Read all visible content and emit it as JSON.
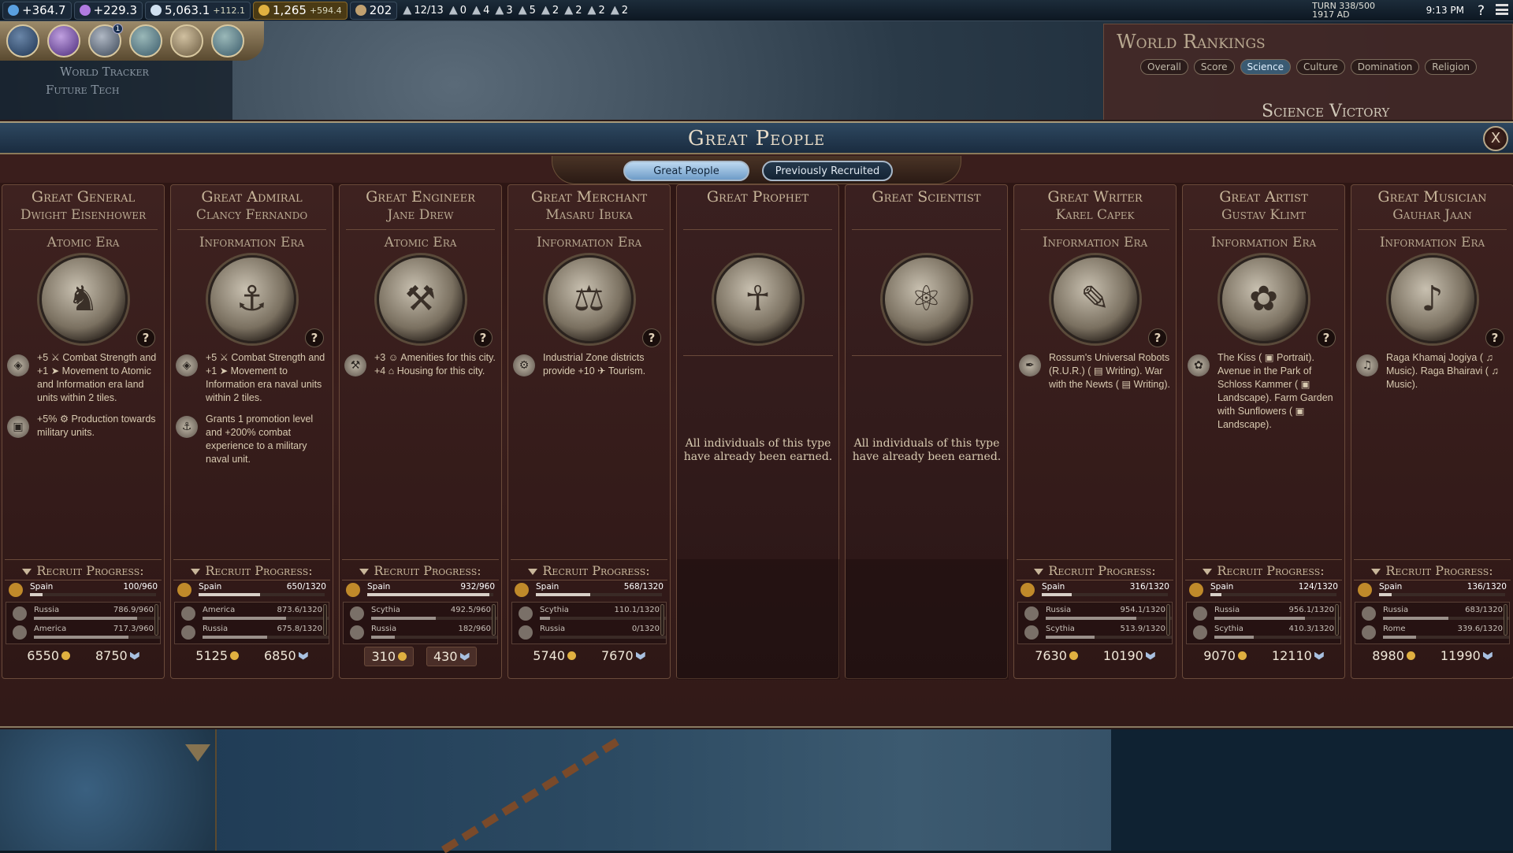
{
  "topbar": {
    "science": "+364.7",
    "culture": "+229.3",
    "faith": "5,063.1",
    "faith_rate": "+112.1",
    "gold": "1,265",
    "gold_rate": "+594.4",
    "tourism": "202",
    "trade_routes": "12/13",
    "stats": [
      "0",
      "4",
      "3",
      "5",
      "2",
      "2",
      "2",
      "2"
    ],
    "turn": "TURN 338/500",
    "year": "1917 AD",
    "clock": "9:13 PM",
    "help": "?"
  },
  "world_tracker": {
    "title": "World Tracker",
    "item": "Future Tech"
  },
  "world_rankings": {
    "title": "World Rankings",
    "tabs": [
      "Overall",
      "Score",
      "Science",
      "Culture",
      "Domination",
      "Religion"
    ],
    "active_tab": "Science",
    "subtitle": "Science Victory"
  },
  "modal": {
    "title": "Great People",
    "close": "X",
    "tabs": [
      "Great People",
      "Previously Recruited"
    ],
    "recruit_label": "Recruit Progress:",
    "help": "?"
  },
  "cards": [
    {
      "type": "Great General",
      "name": "Dwight Eisenhower",
      "era": "Atomic Era",
      "abilities": [
        "+5 ⚔ Combat Strength and +1 ➤ Movement to Atomic and Information era land units within 2 tiles.",
        "+5% ⚙ Production towards military units."
      ],
      "player": {
        "civ": "Spain",
        "progress": "100/960",
        "fraction": 0.1
      },
      "others": [
        {
          "civ": "Russia",
          "progress": "786.9/960",
          "fraction": 0.82
        },
        {
          "civ": "America",
          "progress": "717.3/960",
          "fraction": 0.75
        }
      ],
      "gold_cost": "6550",
      "faith_cost": "8750"
    },
    {
      "type": "Great Admiral",
      "name": "Clancy Fernando",
      "era": "Information Era",
      "abilities": [
        "+5 ⚔ Combat Strength and +1 ➤ Movement to Information era naval units within 2 tiles.",
        "Grants 1 promotion level and +200% combat experience to a military naval unit."
      ],
      "player": {
        "civ": "Spain",
        "progress": "650/1320",
        "fraction": 0.49
      },
      "others": [
        {
          "civ": "America",
          "progress": "873.6/1320",
          "fraction": 0.66
        },
        {
          "civ": "Russia",
          "progress": "675.8/1320",
          "fraction": 0.51
        }
      ],
      "gold_cost": "5125",
      "faith_cost": "6850"
    },
    {
      "type": "Great Engineer",
      "name": "Jane Drew",
      "era": "Atomic Era",
      "abilities": [
        "+3 ☺ Amenities for this city. +4 ⌂ Housing for this city."
      ],
      "player": {
        "civ": "Spain",
        "progress": "932/960",
        "fraction": 0.97
      },
      "others": [
        {
          "civ": "Scythia",
          "progress": "492.5/960",
          "fraction": 0.51
        },
        {
          "civ": "Russia",
          "progress": "182/960",
          "fraction": 0.19
        }
      ],
      "gold_cost": "310",
      "faith_cost": "430"
    },
    {
      "type": "Great Merchant",
      "name": "Masaru Ibuka",
      "era": "Information Era",
      "abilities": [
        "Industrial Zone districts provide +10 ✈ Tourism."
      ],
      "player": {
        "civ": "Spain",
        "progress": "568/1320",
        "fraction": 0.43
      },
      "others": [
        {
          "civ": "Scythia",
          "progress": "110.1/1320",
          "fraction": 0.08
        },
        {
          "civ": "Russia",
          "progress": "0/1320",
          "fraction": 0.0
        }
      ],
      "gold_cost": "5740",
      "faith_cost": "7670"
    },
    {
      "type": "Great Prophet",
      "name": "",
      "era": "",
      "earned": "All individuals of this type have already been earned."
    },
    {
      "type": "Great Scientist",
      "name": "",
      "era": "",
      "earned": "All individuals of this type have already been earned."
    },
    {
      "type": "Great Writer",
      "name": "Karel Capek",
      "era": "Information Era",
      "abilities": [
        "Rossum's Universal Robots (R.U.R.) ( ▤ Writing). War with the Newts ( ▤ Writing)."
      ],
      "player": {
        "civ": "Spain",
        "progress": "316/1320",
        "fraction": 0.24
      },
      "others": [
        {
          "civ": "Russia",
          "progress": "954.1/1320",
          "fraction": 0.72
        },
        {
          "civ": "Scythia",
          "progress": "513.9/1320",
          "fraction": 0.39
        }
      ],
      "gold_cost": "7630",
      "faith_cost": "10190"
    },
    {
      "type": "Great Artist",
      "name": "Gustav Klimt",
      "era": "Information Era",
      "abilities": [
        "The Kiss ( ▣ Portrait). Avenue in the Park of Schloss Kammer ( ▣ Landscape). Farm Garden with Sunflowers ( ▣ Landscape)."
      ],
      "player": {
        "civ": "Spain",
        "progress": "124/1320",
        "fraction": 0.09
      },
      "others": [
        {
          "civ": "Russia",
          "progress": "956.1/1320",
          "fraction": 0.72
        },
        {
          "civ": "Scythia",
          "progress": "410.3/1320",
          "fraction": 0.31
        }
      ],
      "gold_cost": "9070",
      "faith_cost": "12110"
    },
    {
      "type": "Great Musician",
      "name": "Gauhar Jaan",
      "era": "Information Era",
      "abilities": [
        "Raga Khamaj Jogiya ( ♫ Music). Raga Bhairavi ( ♫ Music)."
      ],
      "player": {
        "civ": "Spain",
        "progress": "136/1320",
        "fraction": 0.1
      },
      "others": [
        {
          "civ": "Russia",
          "progress": "683/1320",
          "fraction": 0.52
        },
        {
          "civ": "Rome",
          "progress": "339.6/1320",
          "fraction": 0.26
        }
      ],
      "gold_cost": "8980",
      "faith_cost": "11990"
    }
  ],
  "colors": {
    "panel": "#3a1e1c",
    "titlebar": "#2e4860",
    "gold": "#e0b040",
    "spain": "#c08a2a"
  }
}
